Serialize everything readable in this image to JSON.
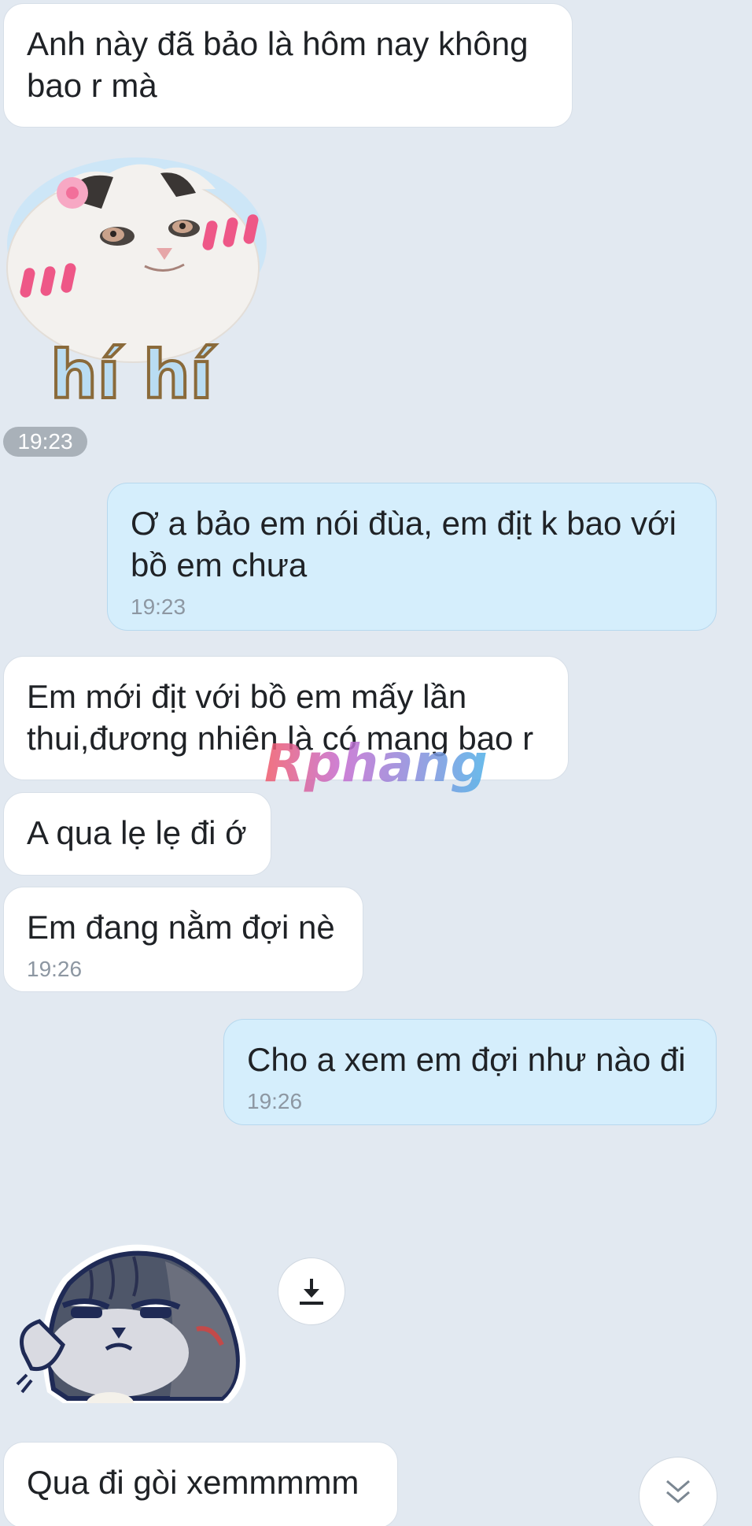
{
  "messages": [
    {
      "text": "Anh này đã bảo là hôm nay không\nbao r mà"
    },
    {
      "text": "Ơ a bảo em nói đùa, em địt k bao với\nbồ em chưa",
      "time": "19:23"
    },
    {
      "text": "Em mới địt với bồ em mấy lần\nthui,đương nhiên là có mang bao r"
    },
    {
      "text": "A qua lẹ lẹ đi ớ"
    },
    {
      "text": "Em đang nằm đợi nè",
      "time": "19:26"
    },
    {
      "text": "Cho a xem em đợi như nào đi",
      "time": "19:26"
    },
    {
      "text": "Qua đi gòi xemmmmm"
    }
  ],
  "stickers": {
    "cat": {
      "caption": "hí hí",
      "time": "19:23"
    }
  },
  "watermark": "Rphang",
  "icons": {
    "download": "download-icon",
    "scroll_down": "double-chevron-down-icon"
  },
  "colors": {
    "background": "#e2e9f1",
    "received_bubble": "#ffffff",
    "sent_bubble": "#d5eefc",
    "timestamp": "#8d97a2"
  }
}
